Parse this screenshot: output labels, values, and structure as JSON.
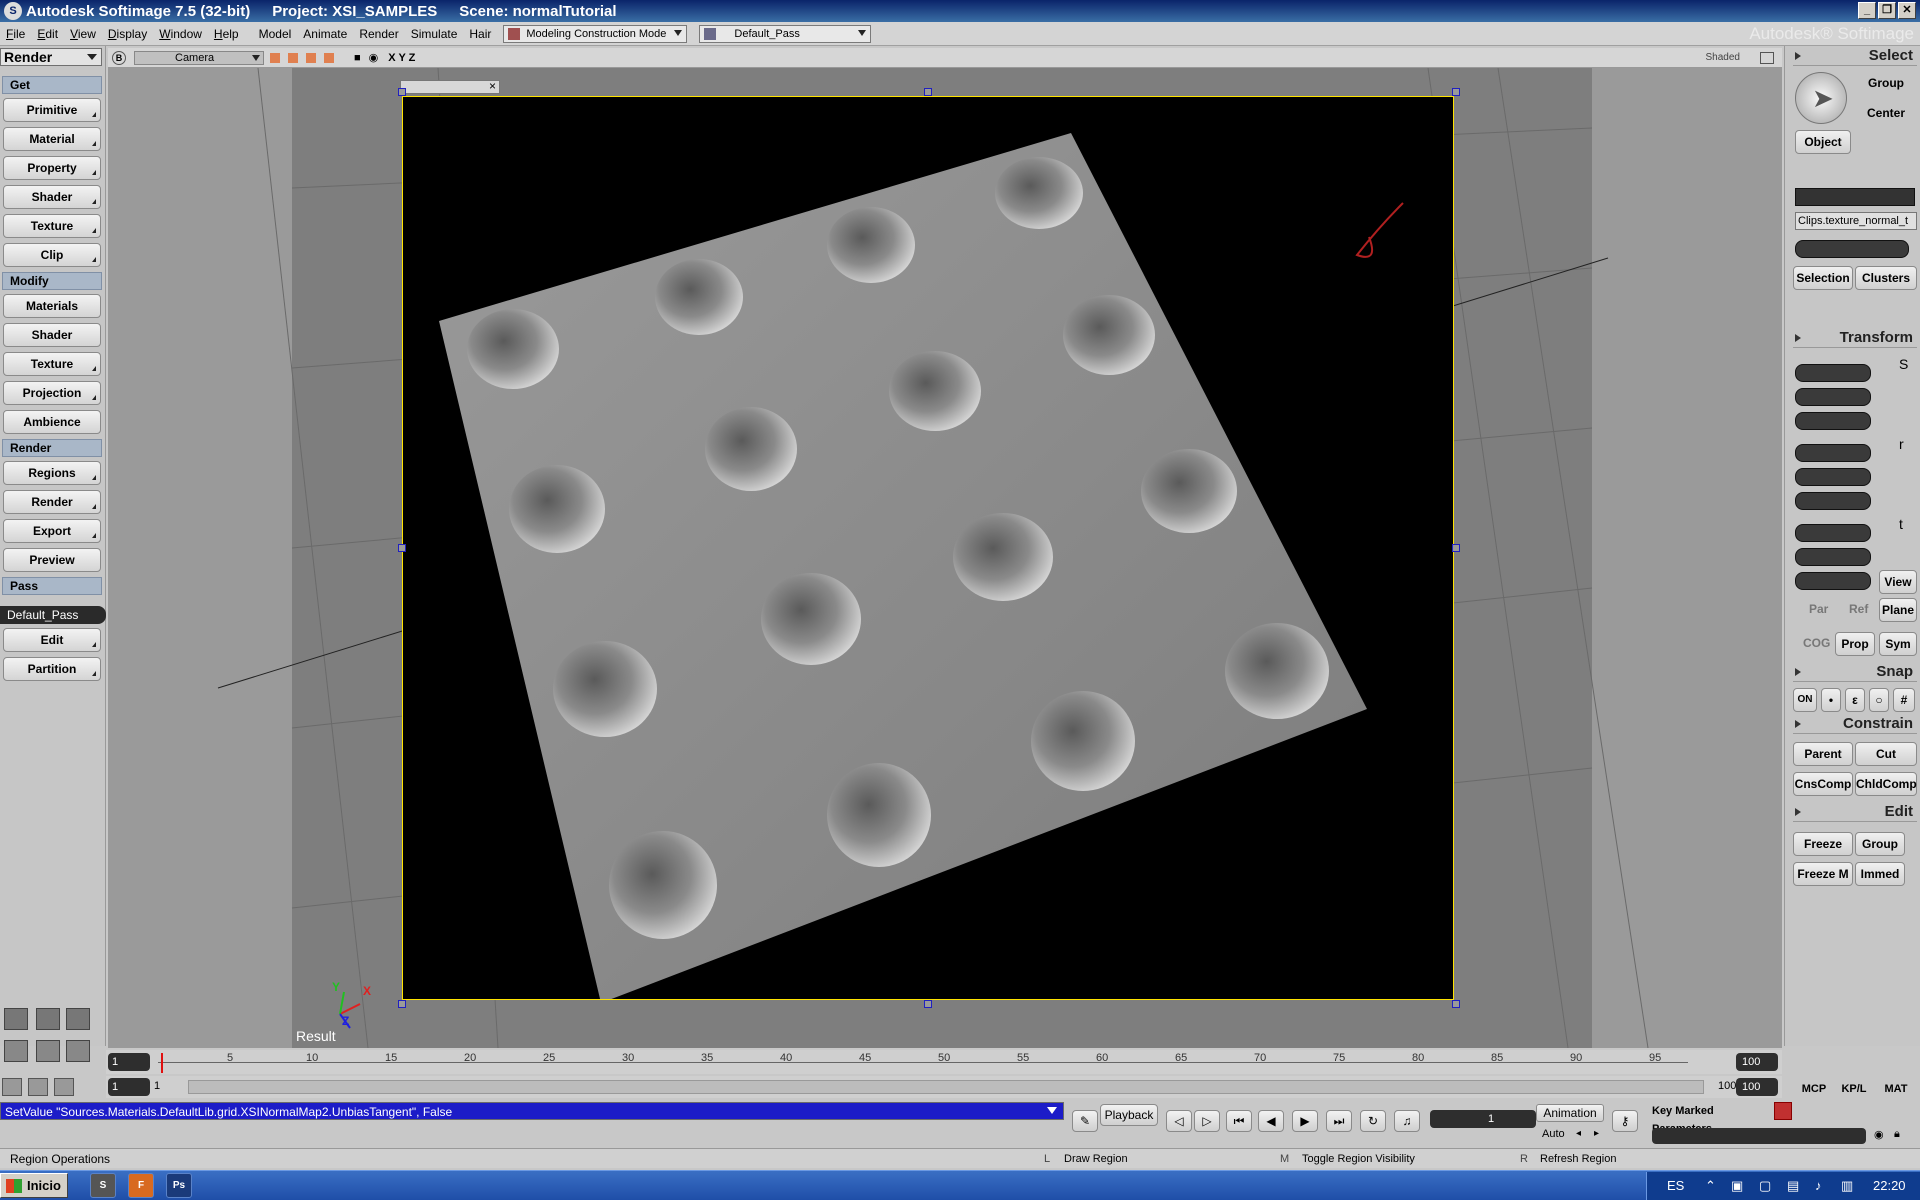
{
  "titlebar": {
    "app": "Autodesk Softimage 7.5 (32-bit)",
    "project": "Project: XSI_SAMPLES",
    "scene": "Scene: normalTutorial",
    "brand": "Autodesk® Softimage"
  },
  "menubar": {
    "items": [
      "File",
      "Edit",
      "View",
      "Display",
      "Window",
      "Help",
      "Model",
      "Animate",
      "Render",
      "Simulate",
      "Hair"
    ],
    "construction_mode": "Modeling Construction Mode",
    "pass": "Default_Pass"
  },
  "leftpanel": {
    "mode": "Render",
    "sections": {
      "get": "Get",
      "modify": "Modify",
      "render": "Render",
      "pass": "Pass"
    },
    "get_buttons": [
      "Primitive",
      "Material",
      "Property",
      "Shader",
      "Texture",
      "Clip"
    ],
    "modify_buttons": [
      "Materials",
      "Shader",
      "Texture",
      "Projection",
      "Ambience"
    ],
    "render_buttons": [
      "Regions",
      "Render",
      "Export",
      "Preview"
    ],
    "pass_name": "Default_Pass",
    "pass_buttons": [
      "Edit",
      "Partition"
    ]
  },
  "viewport": {
    "camera": "Camera",
    "axes": "X Y Z",
    "shading": "Shaded",
    "result_label": "Result",
    "axis_x": "X",
    "axis_y": "Y",
    "axis_z": "Z"
  },
  "rightpanel": {
    "select_head": "Select",
    "group": "Group",
    "center": "Center",
    "object": "Object",
    "clip_field": "Clips.texture_normal_t",
    "selection": "Selection",
    "clusters": "Clusters",
    "transform_head": "Transform",
    "view": "View",
    "par": "Par",
    "ref": "Ref",
    "plane": "Plane",
    "cog": "COG",
    "prop": "Prop",
    "sym": "Sym",
    "snap_head": "Snap",
    "on": "ON",
    "constrain_head": "Constrain",
    "parent": "Parent",
    "cut": "Cut",
    "cnscomp": "CnsComp",
    "chldcomp": "ChldComp",
    "edit_head": "Edit",
    "freeze": "Freeze",
    "group2": "Group",
    "freeze_m": "Freeze M",
    "immed": "Immed"
  },
  "timeline": {
    "start": "1",
    "end": "100",
    "ticks": [
      "5",
      "10",
      "15",
      "20",
      "25",
      "30",
      "35",
      "40",
      "45",
      "50",
      "55",
      "60",
      "65",
      "70",
      "75",
      "80",
      "85",
      "90",
      "95"
    ],
    "row2_start": "1",
    "row2_frame": "1",
    "row2_end": "100",
    "row2_end2": "100"
  },
  "bottom": {
    "script": "SetValue \"Sources.Materials.DefaultLib.grid.XSINormalMap2.UnbiasTangent\", False",
    "playback": "Playback",
    "frame": "1",
    "animation": "Animation",
    "auto": "Auto",
    "key_marked": "Key Marked Parameters",
    "mcp": "MCP",
    "kpl": "KP/L",
    "mat": "MAT"
  },
  "statusbar": {
    "left": "Region Operations",
    "l_key": "L",
    "l_text": "Draw Region",
    "m_key": "M",
    "m_text": "Toggle Region Visibility",
    "r_key": "R",
    "r_text": "Refresh Region"
  },
  "taskbar": {
    "start": "Inicio",
    "lang": "ES",
    "time": "22:20"
  },
  "colors": {
    "title_bg": "#0a246a",
    "script_bg": "#1c1cc8",
    "render_border": "#ffe400",
    "taskbar": "#245edb"
  }
}
